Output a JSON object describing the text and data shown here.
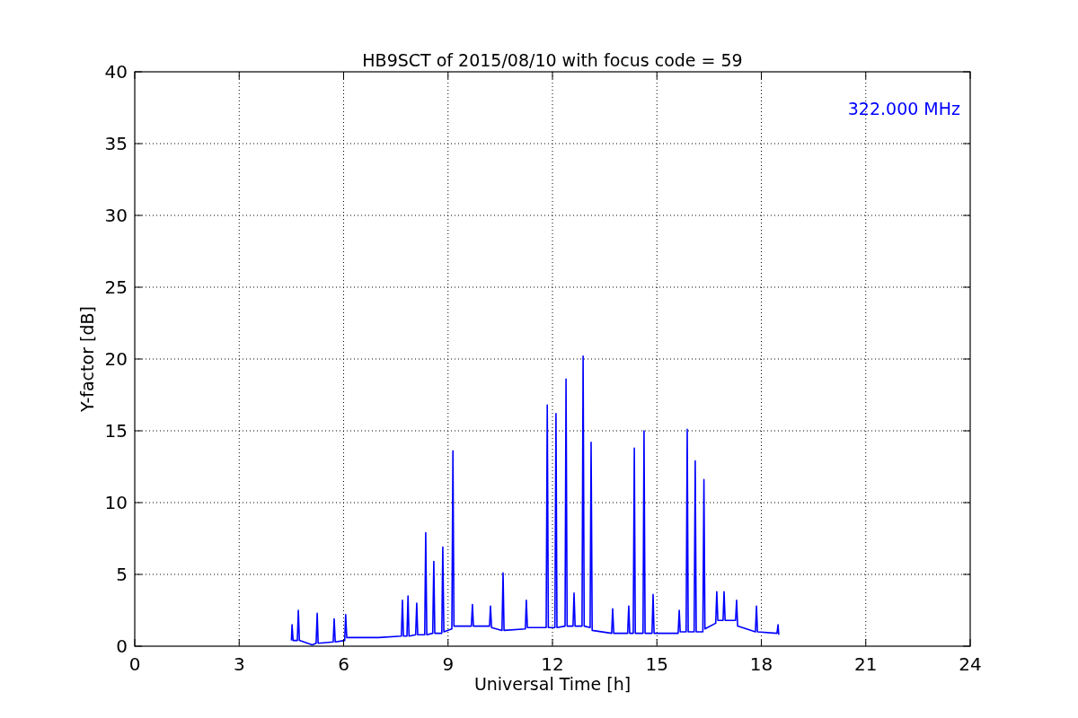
{
  "figure": {
    "chart_data": {
      "type": "line",
      "title": "HB9SCT of 2015/08/10 with focus code = 59",
      "xlabel": "Universal Time [h]",
      "ylabel": "Y-factor [dB]",
      "xlim": [
        0,
        24
      ],
      "ylim": [
        0,
        40
      ],
      "xticks": [
        0,
        3,
        6,
        9,
        12,
        15,
        18,
        21,
        24
      ],
      "yticks": [
        0,
        5,
        10,
        15,
        20,
        25,
        30,
        35,
        40
      ],
      "grid": true,
      "x": [
        4.5,
        4.52,
        4.55,
        4.67,
        4.7,
        4.73,
        5.1,
        5.21,
        5.24,
        5.27,
        5.7,
        5.73,
        5.76,
        6.03,
        6.06,
        6.09,
        7.0,
        7.66,
        7.69,
        7.72,
        7.82,
        7.85,
        7.88,
        8.07,
        8.1,
        8.13,
        8.33,
        8.36,
        8.39,
        8.56,
        8.59,
        8.62,
        8.82,
        8.85,
        8.88,
        9.11,
        9.14,
        9.17,
        9.67,
        9.7,
        9.73,
        10.19,
        10.22,
        10.25,
        10.55,
        10.58,
        10.61,
        11.22,
        11.25,
        11.28,
        11.82,
        11.85,
        11.88,
        12.07,
        12.1,
        12.13,
        12.36,
        12.39,
        12.42,
        12.59,
        12.62,
        12.65,
        12.85,
        12.88,
        12.91,
        13.08,
        13.11,
        13.14,
        13.7,
        13.73,
        13.76,
        14.16,
        14.19,
        14.22,
        14.32,
        14.35,
        14.38,
        14.6,
        14.63,
        14.66,
        14.86,
        14.89,
        14.92,
        15.61,
        15.64,
        15.67,
        15.84,
        15.87,
        15.9,
        16.07,
        16.1,
        16.13,
        16.32,
        16.35,
        16.38,
        16.69,
        16.72,
        16.75,
        16.9,
        16.93,
        16.96,
        17.26,
        17.29,
        17.32,
        17.83,
        17.86,
        17.89,
        18.45,
        18.48,
        18.5
      ],
      "series": [
        {
          "name": "322.000 MHz",
          "color": "#0000ff",
          "values": [
            0.4,
            1.5,
            0.4,
            0.4,
            2.5,
            0.4,
            0.1,
            0.2,
            2.3,
            0.2,
            0.3,
            1.9,
            0.3,
            0.4,
            2.2,
            0.6,
            0.6,
            0.7,
            3.2,
            0.7,
            0.7,
            3.5,
            0.7,
            0.8,
            3.0,
            0.8,
            0.8,
            7.9,
            0.8,
            0.9,
            5.9,
            0.9,
            0.9,
            6.9,
            1.0,
            1.2,
            13.6,
            1.4,
            1.4,
            2.9,
            1.4,
            1.4,
            2.8,
            1.3,
            1.1,
            5.1,
            1.1,
            1.2,
            3.2,
            1.3,
            1.3,
            16.8,
            1.3,
            1.3,
            16.2,
            1.3,
            1.4,
            18.6,
            1.4,
            1.4,
            3.7,
            1.4,
            1.4,
            20.2,
            1.4,
            1.3,
            14.2,
            1.1,
            0.9,
            2.6,
            0.9,
            0.9,
            2.8,
            0.9,
            0.9,
            13.8,
            0.9,
            0.9,
            15.0,
            0.9,
            0.9,
            3.6,
            0.9,
            0.9,
            2.5,
            1.0,
            1.0,
            15.1,
            1.0,
            1.0,
            12.9,
            1.0,
            1.0,
            11.6,
            1.2,
            1.6,
            3.8,
            1.8,
            1.8,
            3.8,
            1.8,
            1.8,
            3.2,
            1.4,
            1.0,
            2.8,
            1.0,
            0.9,
            1.5,
            0.8
          ]
        }
      ]
    }
  }
}
